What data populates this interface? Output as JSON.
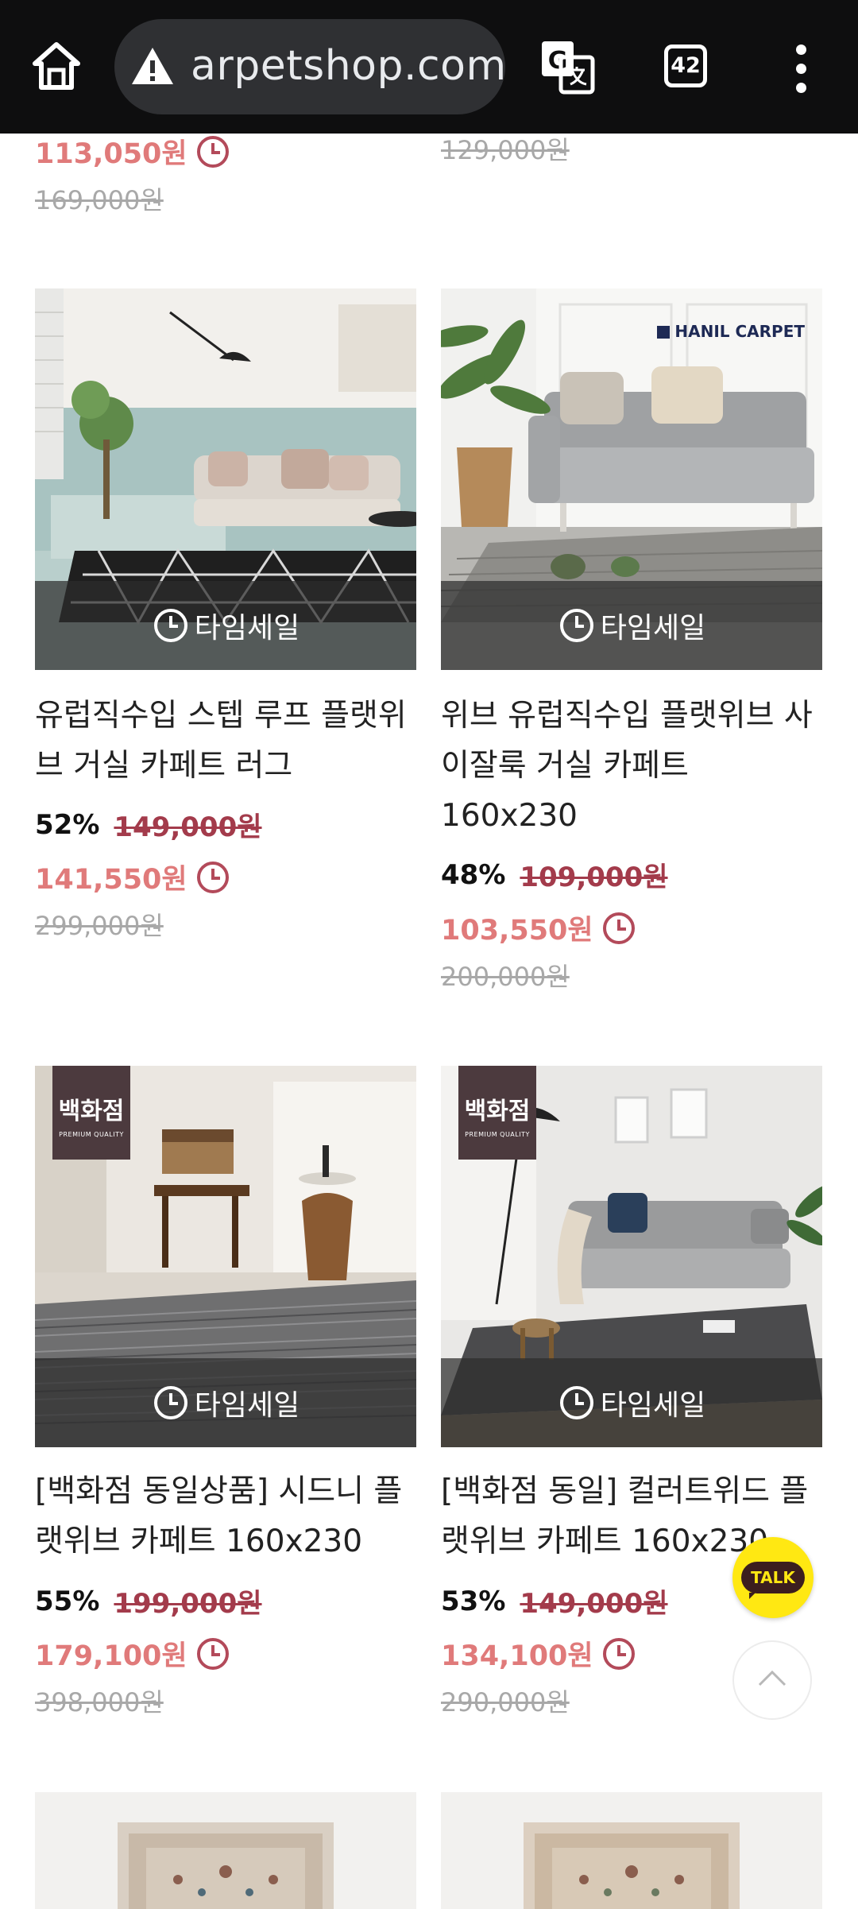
{
  "browser": {
    "url": "arpetshop.com",
    "tab_count": "42"
  },
  "timesale_label": "타임세일",
  "top_row": [
    {
      "sale_price": "113,050원",
      "original_price": "169,000원"
    },
    {
      "original_price": "129,000원"
    }
  ],
  "products": [
    {
      "title": "유럽직수입 스텝 루프 플랫위브 거실 카페트 러그",
      "discount_pct": "52%",
      "list_price": "149,000원",
      "sale_price": "141,550원",
      "original_price": "299,000원"
    },
    {
      "title": "위브 유럽직수입 플랫위브 사이잘룩 거실 카페트 160x230",
      "brand_logo": "HANIL CARPET",
      "discount_pct": "48%",
      "list_price": "109,000원",
      "sale_price": "103,550원",
      "original_price": "200,000원"
    },
    {
      "title": "[백화점 동일상품] 시드니 플랫위브 카페트 160x230",
      "badge": "백화점",
      "badge_sub": "PREMIUM QUALITY",
      "discount_pct": "55%",
      "list_price": "199,000원",
      "sale_price": "179,100원",
      "original_price": "398,000원"
    },
    {
      "title": "[백화점 동일] 컬러트위드 플랫위브 카페트 160x230",
      "badge": "백화점",
      "badge_sub": "PREMIUM QUALITY",
      "discount_pct": "53%",
      "list_price": "149,000원",
      "sale_price": "134,100원",
      "original_price": "290,000원"
    }
  ],
  "floating": {
    "talk_label": "TALK"
  },
  "colors": {
    "sale_price": "#e07a7a",
    "clock_icon": "#b34a5a",
    "strike_price": "#a33b4b",
    "talk_button": "#ffe812"
  }
}
